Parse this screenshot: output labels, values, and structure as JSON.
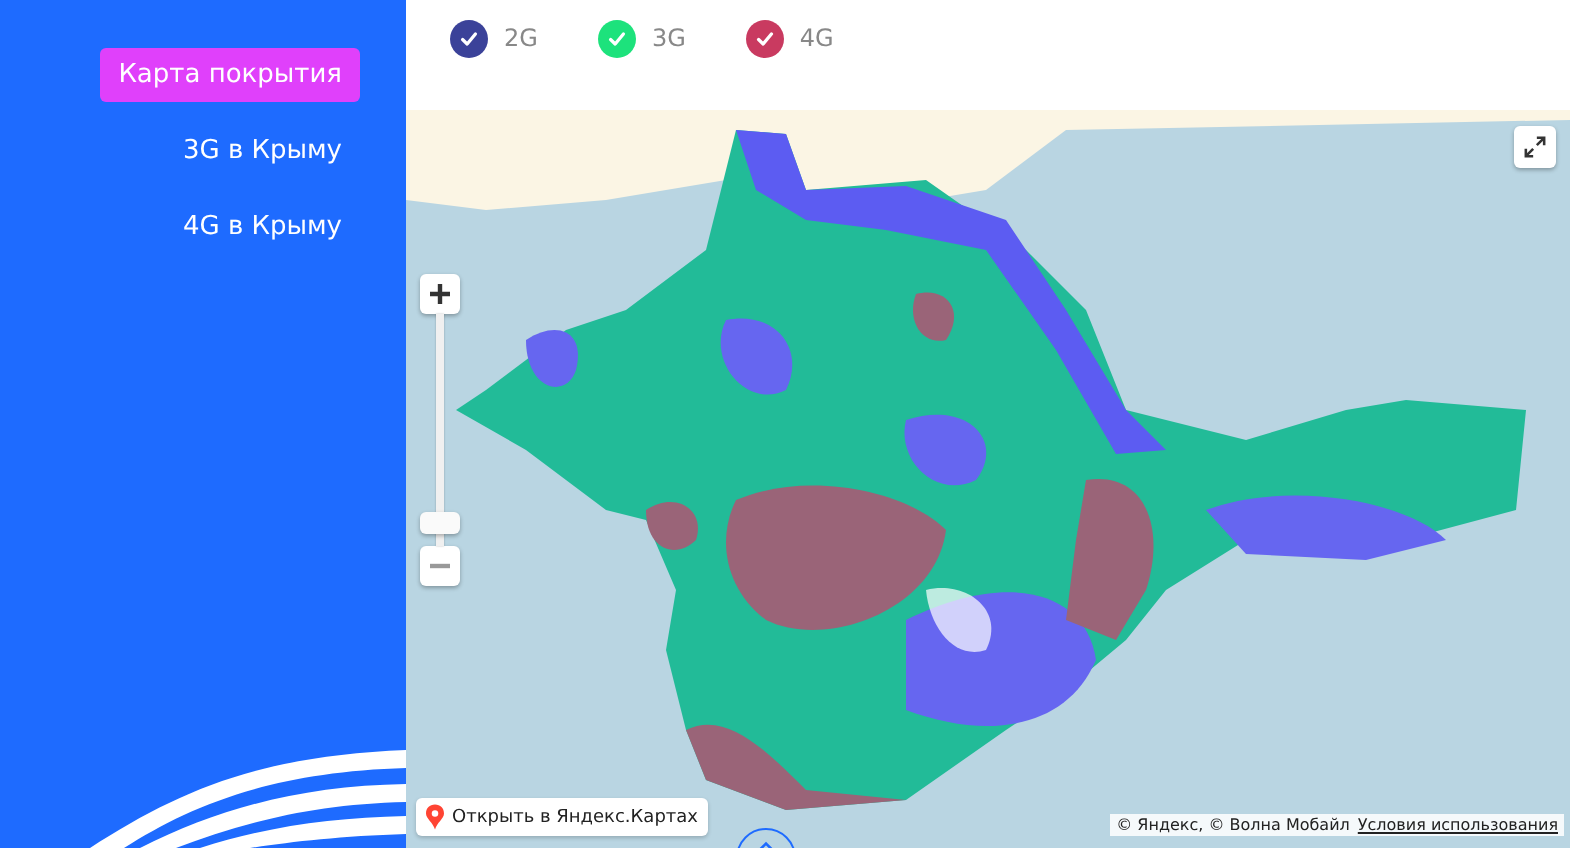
{
  "sidebar": {
    "items": [
      {
        "label": "Карта покрытия",
        "selected": true
      },
      {
        "label": "3G в Крыму",
        "selected": false
      },
      {
        "label": "4G в Крыму",
        "selected": false
      }
    ]
  },
  "legend": [
    {
      "label": "2G",
      "checked": true,
      "color": "#3b4299"
    },
    {
      "label": "3G",
      "checked": true,
      "color": "#1de27c"
    },
    {
      "label": "4G",
      "checked": true,
      "color": "#c93a60"
    }
  ],
  "map": {
    "zoom": {
      "level": 0.05
    },
    "open_link": "Открыть в Яндекс.Картах",
    "attribution": "© Яндекс, © Волна Мобайл",
    "terms_link": "Условия использования"
  }
}
